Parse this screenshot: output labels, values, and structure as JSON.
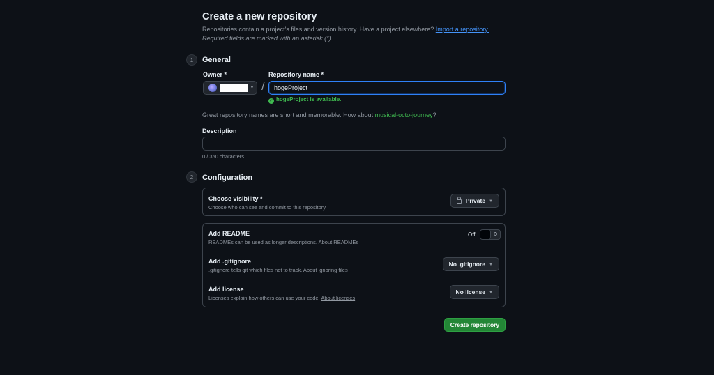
{
  "header": {
    "title": "Create a new repository",
    "intro_text": "Repositories contain a project's files and version history. Have a project elsewhere?",
    "import_link": "Import a repository.",
    "required_note": "Required fields are marked with an asterisk (*)."
  },
  "steps": [
    {
      "number": "1",
      "title": "General"
    },
    {
      "number": "2",
      "title": "Configuration"
    }
  ],
  "general": {
    "owner_label": "Owner *",
    "repo_label": "Repository name *",
    "separator": "/",
    "repo_value": "hogeProject",
    "availability": "hogeProject is available.",
    "hint_text": "Great repository names are short and memorable. How about",
    "hint_suggestion": "musical-octo-journey",
    "hint_end": "?",
    "description_label": "Description",
    "description_value": "",
    "char_count": "0 / 350 characters"
  },
  "configuration": {
    "visibility": {
      "title": "Choose visibility *",
      "desc": "Choose who can see and commit to this repository",
      "value": "Private"
    },
    "readme": {
      "title": "Add README",
      "desc": "READMEs can be used as longer descriptions.",
      "link": "About READMEs",
      "toggle_label": "Off"
    },
    "gitignore": {
      "title": "Add .gitignore",
      "desc": ".gitignore tells git which files not to track.",
      "link": "About ignoring files",
      "value": "No .gitignore"
    },
    "license": {
      "title": "Add license",
      "desc": "Licenses explain how others can use your code.",
      "link": "About licenses",
      "value": "No license"
    }
  },
  "actions": {
    "create_label": "Create repository"
  },
  "colors": {
    "background": "#0d1117",
    "accent_blue": "#4493f8",
    "success_green": "#3fb950",
    "primary_button": "#238636"
  }
}
